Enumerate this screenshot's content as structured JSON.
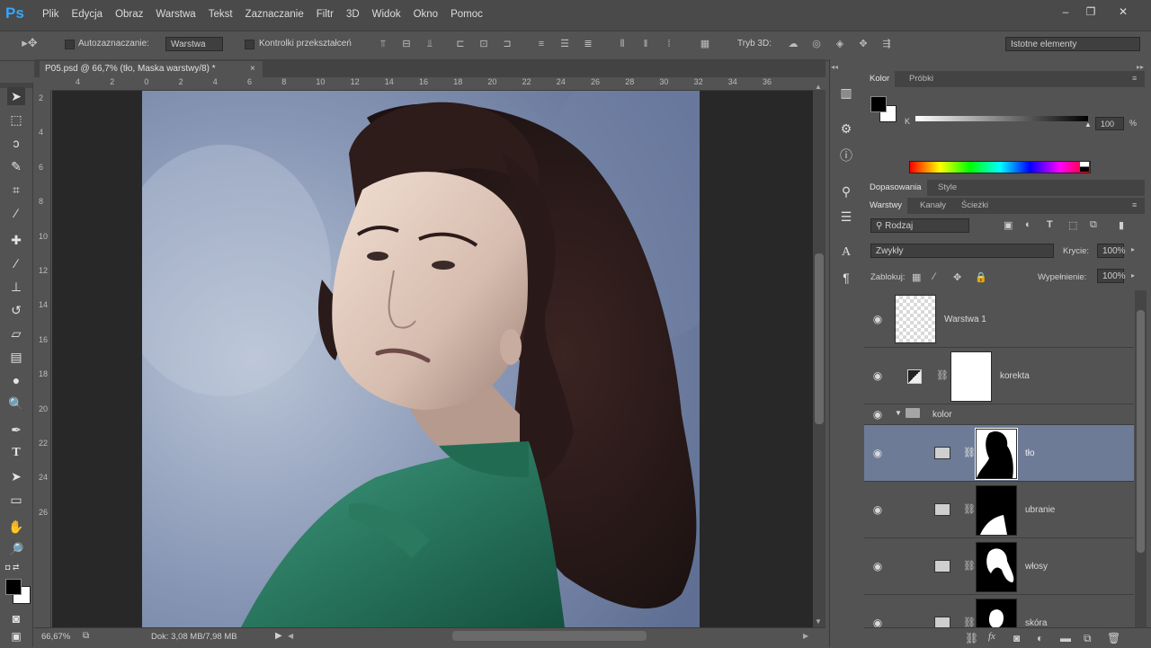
{
  "app": {
    "logo": "Ps"
  },
  "menu": [
    "Plik",
    "Edycja",
    "Obraz",
    "Warstwa",
    "Tekst",
    "Zaznaczanie",
    "Filtr",
    "3D",
    "Widok",
    "Okno",
    "Pomoc"
  ],
  "window_controls": {
    "minimize": "–",
    "restore": "❐",
    "close": "✕"
  },
  "options": {
    "auto_select_label": "Autozaznaczanie:",
    "auto_select_value": "Warstwa",
    "transform_controls_label": "Kontrolki przekształceń",
    "mode3d_label": "Tryb 3D:",
    "workspace_value": "Istotne elementy"
  },
  "document": {
    "tab_title": "P05.psd @ 66,7% (tło, Maska warstwy/8) *",
    "zoom": "66,67%",
    "doc_size": "Dok: 3,08 MB/7,98 MB",
    "ruler_top": [
      "4",
      "2",
      "0",
      "2",
      "4",
      "6",
      "8",
      "10",
      "12",
      "14",
      "16",
      "18",
      "20",
      "22",
      "24",
      "26",
      "28",
      "30",
      "32",
      "34",
      "36"
    ],
    "ruler_left": [
      "2",
      "4",
      "6",
      "8",
      "10",
      "12",
      "14",
      "16",
      "18",
      "20",
      "22",
      "24",
      "26"
    ]
  },
  "color_panel": {
    "tabs": [
      "Kolor",
      "Próbki"
    ],
    "channel": "K",
    "value": "100",
    "unit": "%",
    "fg_color": "#000000",
    "bg_color": "#ffffff"
  },
  "adjust_panel": {
    "tabs": [
      "Dopasowania",
      "Style"
    ]
  },
  "layers_panel": {
    "tabs": [
      "Warstwy",
      "Kanały",
      "Ścieżki"
    ],
    "filter_label": "Rodzaj",
    "blend_mode": "Zwykły",
    "opacity_label": "Krycie:",
    "opacity_value": "100%",
    "lock_label": "Zablokuj:",
    "fill_label": "Wypełnienie:",
    "fill_value": "100%",
    "layers": [
      {
        "name": "Warstwa 1",
        "kind": "pixel"
      },
      {
        "name": "korekta",
        "kind": "adjustment"
      },
      {
        "name": "kolor",
        "kind": "group"
      },
      {
        "name": "tło",
        "kind": "masked",
        "selected": true
      },
      {
        "name": "ubranie",
        "kind": "masked"
      },
      {
        "name": "włosy",
        "kind": "masked"
      },
      {
        "name": "skóra",
        "kind": "masked"
      }
    ],
    "footer_icons": [
      "link-icon",
      "fx-icon",
      "mask-icon",
      "adjustment-icon",
      "group-icon",
      "new-layer-icon",
      "trash-icon"
    ]
  },
  "colors": {
    "selected_layer": "#6d7b96",
    "accent": "#31a8ff"
  }
}
